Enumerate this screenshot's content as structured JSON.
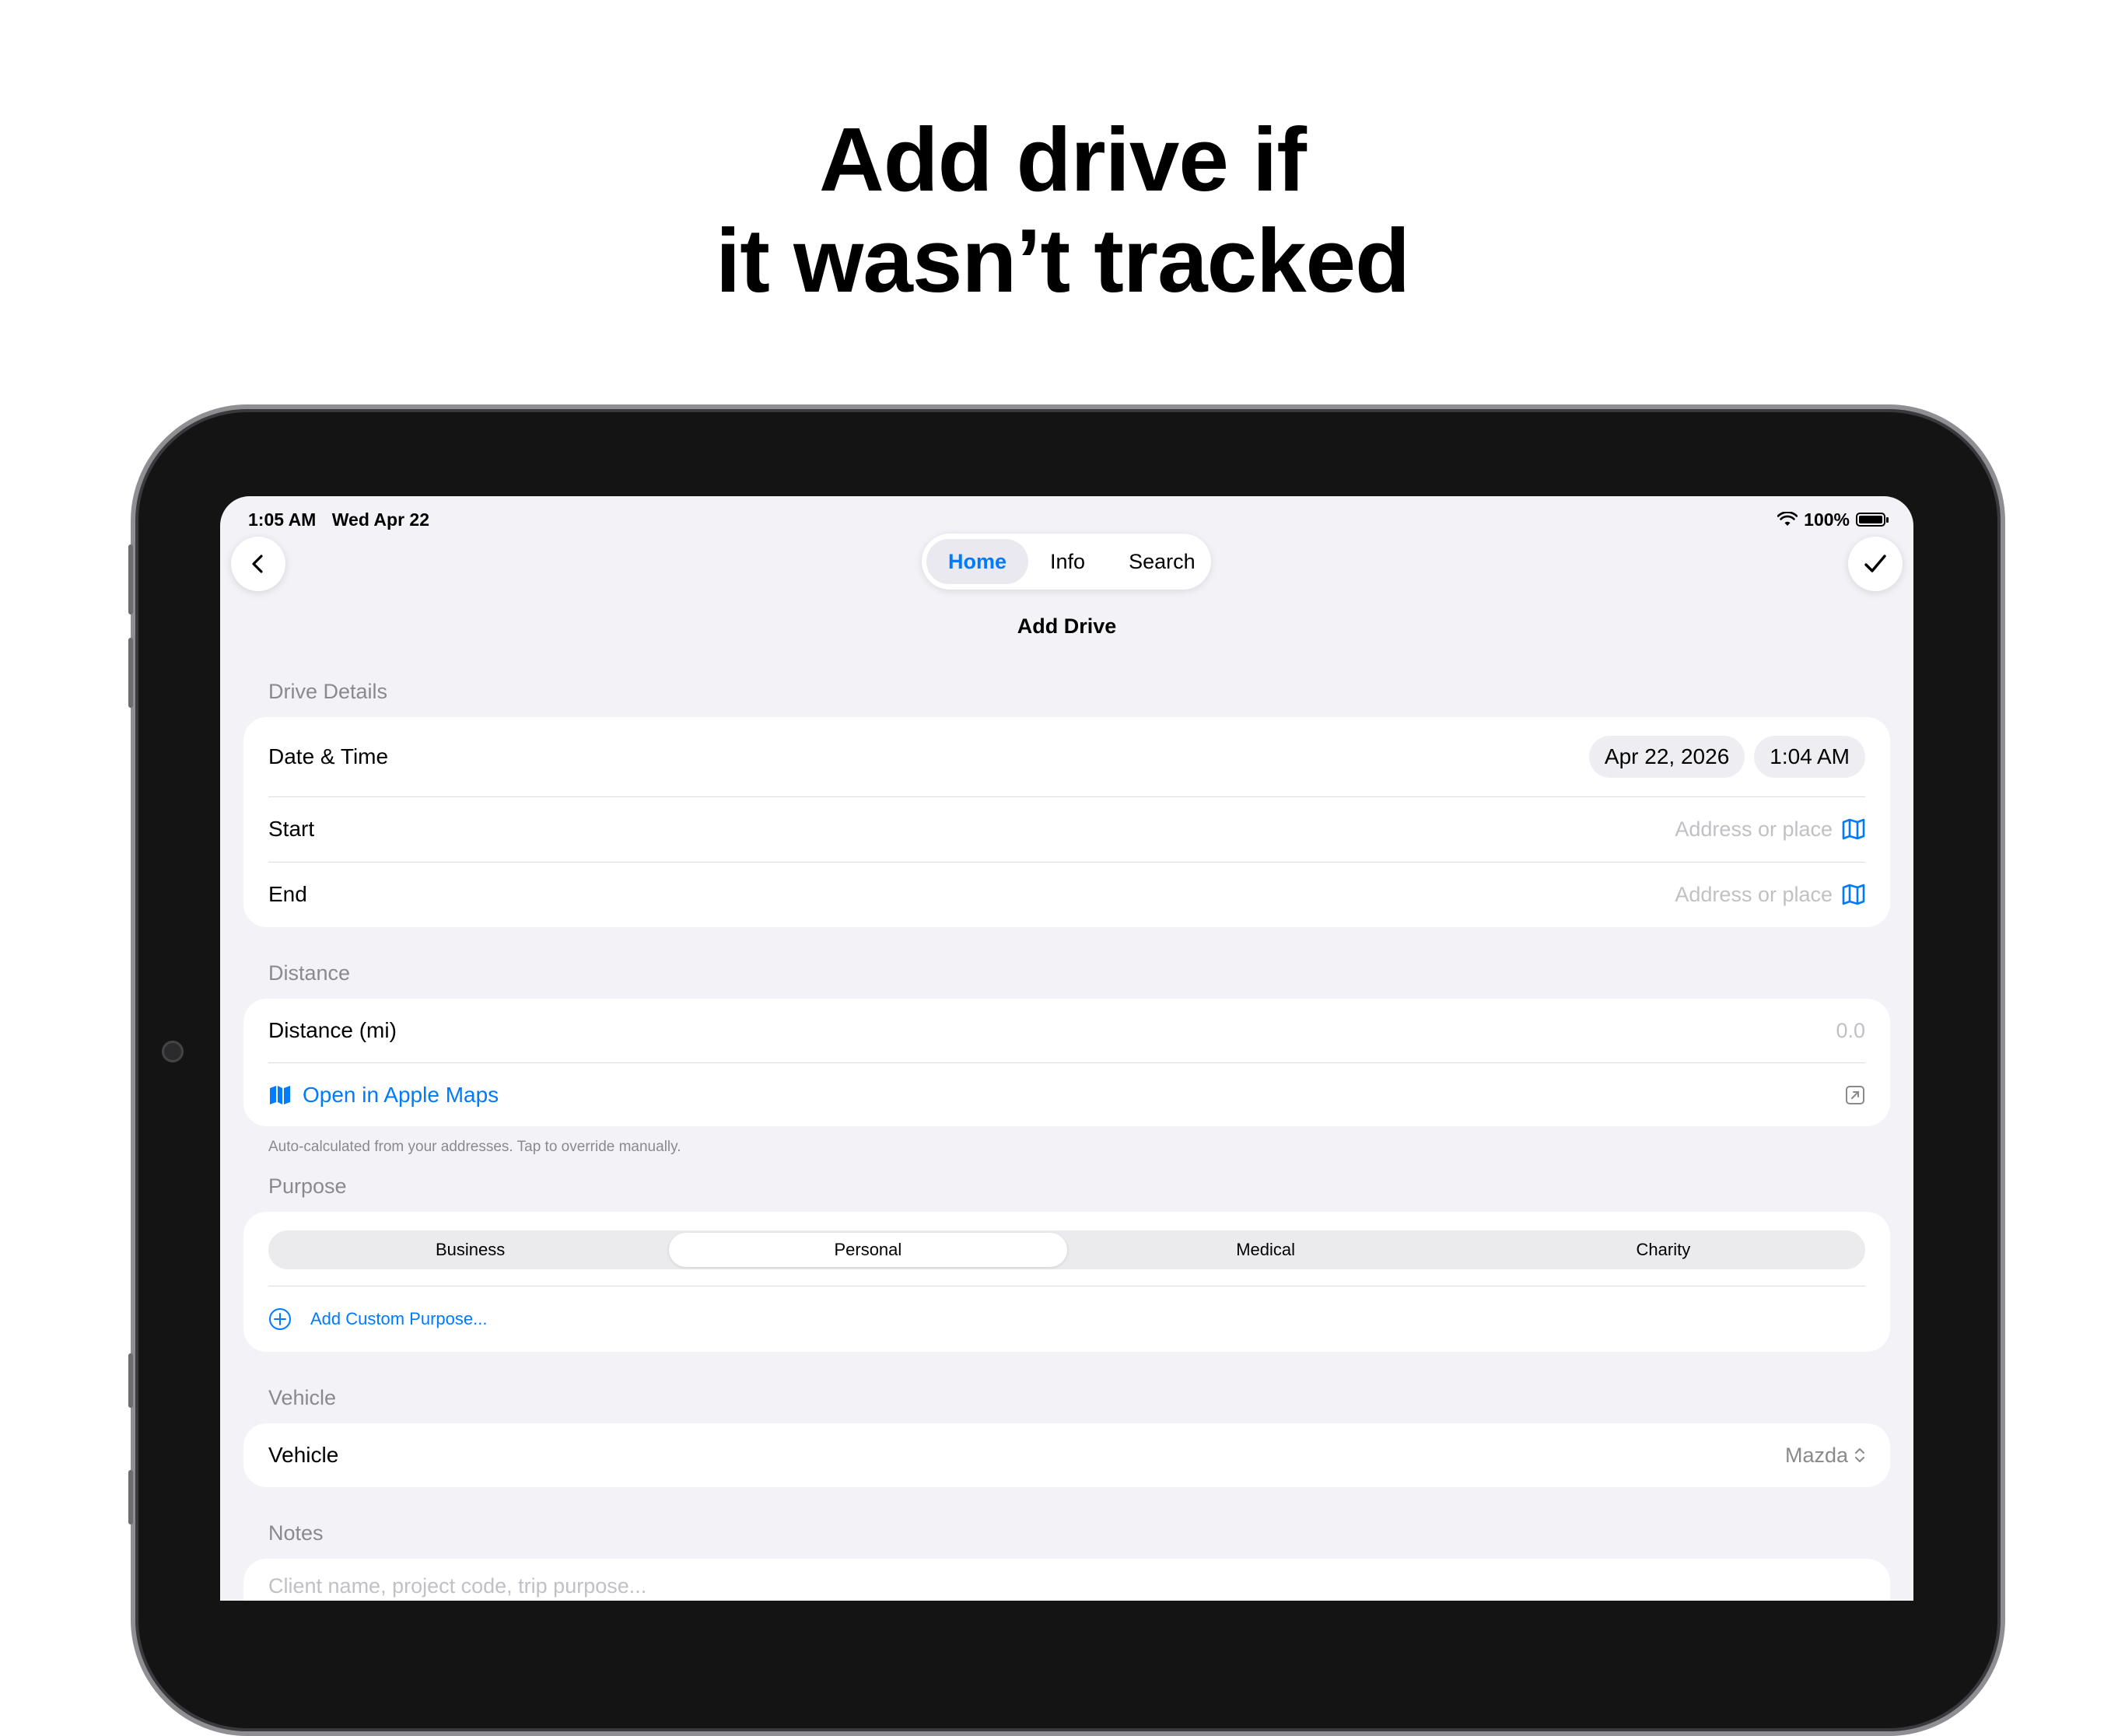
{
  "headline": {
    "line1": "Add drive if",
    "line2": "it wasn’t tracked"
  },
  "status_bar": {
    "time": "1:05 AM",
    "date": "Wed Apr 22",
    "battery": "100%"
  },
  "nav": {
    "tabs": [
      {
        "label": "Home"
      },
      {
        "label": "Info"
      },
      {
        "label": "Search"
      }
    ],
    "title": "Add Drive"
  },
  "drive_details": {
    "header": "Drive Details",
    "date_time_label": "Date & Time",
    "date_value": "Apr 22, 2026",
    "time_value": "1:04 AM",
    "start_label": "Start",
    "start_placeholder": "Address or place",
    "end_label": "End",
    "end_placeholder": "Address or place"
  },
  "distance": {
    "header": "Distance",
    "label": "Distance (mi)",
    "value": "0.0",
    "maps_link": "Open in Apple Maps",
    "footnote": "Auto-calculated from your addresses. Tap to override manually."
  },
  "purpose": {
    "header": "Purpose",
    "options": [
      "Business",
      "Personal",
      "Medical",
      "Charity"
    ],
    "selected": "Personal",
    "add_custom": "Add Custom Purpose..."
  },
  "vehicle": {
    "header": "Vehicle",
    "label": "Vehicle",
    "value": "Mazda"
  },
  "notes": {
    "header": "Notes",
    "placeholder": "Client name, project code, trip purpose..."
  },
  "colors": {
    "accent": "#007aff",
    "background": "#f2f2f7",
    "secondary_text": "#8a8a8e"
  }
}
